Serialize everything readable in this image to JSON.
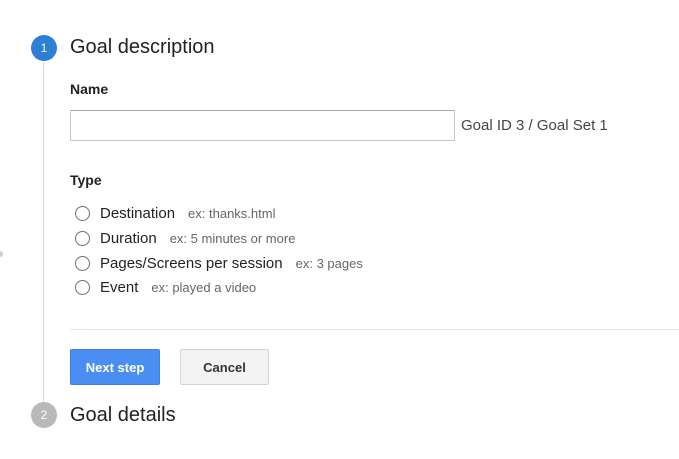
{
  "steps": [
    {
      "number": "1",
      "title": "Goal description",
      "state": "active"
    },
    {
      "number": "2",
      "title": "Goal details",
      "state": "inactive"
    }
  ],
  "name_field": {
    "label": "Name",
    "value": "",
    "placeholder": "",
    "goal_id_text": "Goal ID 3 / Goal Set 1"
  },
  "type_field": {
    "label": "Type",
    "options": [
      {
        "label": "Destination",
        "example": "ex: thanks.html",
        "selected": false
      },
      {
        "label": "Duration",
        "example": "ex: 5 minutes or more",
        "selected": false
      },
      {
        "label": "Pages/Screens per session",
        "example": "ex: 3 pages",
        "selected": false
      },
      {
        "label": "Event",
        "example": "ex: played a video",
        "selected": false
      }
    ]
  },
  "buttons": {
    "next_label": "Next step",
    "cancel_label": "Cancel"
  },
  "colors": {
    "step_active": "#2d7fd3",
    "step_inactive": "#b9b9b9",
    "primary_button": "#4b8ef2"
  }
}
